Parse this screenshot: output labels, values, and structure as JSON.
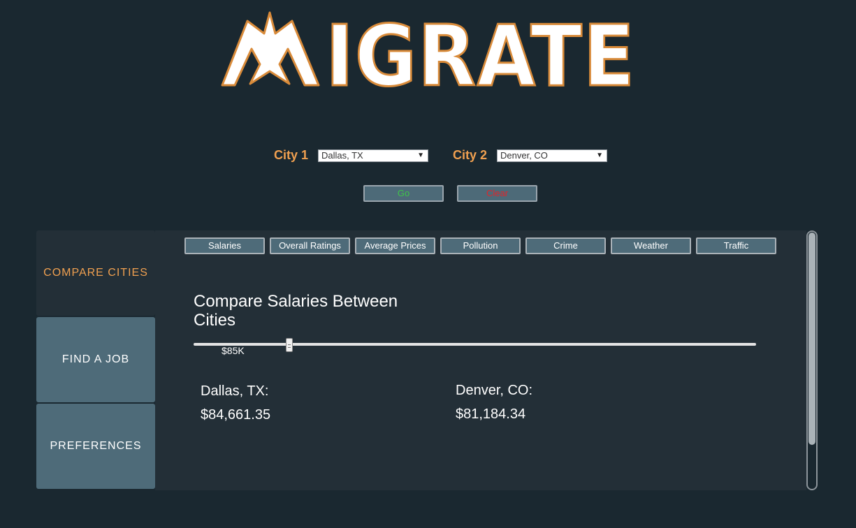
{
  "logo": {
    "text": "MIGRATE",
    "icon": "swallow-bird-icon"
  },
  "city_picker": {
    "city1_label": "City 1",
    "city1_value": "Dallas, TX",
    "city2_label": "City 2",
    "city2_value": "Denver, CO"
  },
  "actions": {
    "go_label": "Go",
    "clear_label": "Clear"
  },
  "sidebar": {
    "items": [
      {
        "label": "COMPARE CITIES",
        "active": true
      },
      {
        "label": "FIND A JOB",
        "active": false
      },
      {
        "label": "PREFERENCES",
        "active": false
      }
    ]
  },
  "tabs": [
    "Salaries",
    "Overall Ratings",
    "Average Prices",
    "Pollution",
    "Crime",
    "Weather",
    "Traffic"
  ],
  "compare": {
    "title": "Compare Salaries Between Cities",
    "slider_label": "$85K",
    "slider_fraction": 0.17,
    "city1_name": "Dallas, TX:",
    "city1_value": "$84,661.35",
    "city2_name": "Denver, CO:",
    "city2_value": "$81,184.34"
  },
  "colors": {
    "background": "#1a2830",
    "panel": "#232f37",
    "accent": "#f0a050",
    "button": "#4e6b79",
    "go": "#3fc34a",
    "clear": "#e0252b"
  }
}
